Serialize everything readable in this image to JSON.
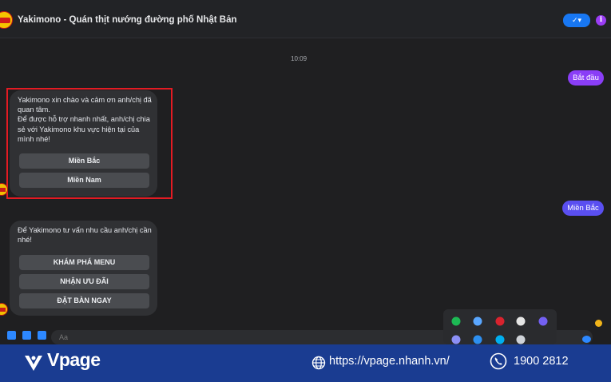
{
  "header": {
    "title": "Yakimono - Quán thịt nướng đường phố Nhật Bản",
    "seen_label": "✓▾",
    "info_label": "i"
  },
  "conversation": {
    "timestamp": "10:09",
    "user_messages": [
      "Bắt đầu",
      "Miền Bắc"
    ],
    "bot_message_1": {
      "text": "Yakimono xin chào và cảm ơn anh/chị đã quan tâm.\nĐể được hỗ trợ nhanh nhất, anh/chị chia sẻ với Yakimono khu vực hiện tại của mình nhé!",
      "buttons": [
        "Miền Bắc",
        "Miền Nam"
      ]
    },
    "bot_message_2": {
      "text": "Để Yakimono tư vấn nhu cầu anh/chị cần nhé!",
      "buttons": [
        "KHÁM PHÁ MENU",
        "NHẬN ƯU ĐÃI",
        "ĐẶT BÀN NGAY"
      ]
    }
  },
  "composer": {
    "placeholder": "Aa"
  },
  "tray": {
    "icons": [
      "spotify-icon",
      "onedrive-icon",
      "vivaldi-icon",
      "chrome-icon",
      "viber-icon",
      "send-icon",
      "edge-icon",
      "skype-icon",
      "gmail-icon"
    ],
    "colors": [
      "#1db954",
      "#5aa7ff",
      "#d9232e",
      "#e5e5e5",
      "#7360f2",
      "#8b8ff5",
      "#2d8ff0",
      "#00aff0",
      "#cfd3d8"
    ]
  },
  "footer": {
    "brand": "Vpage",
    "url": "https://vpage.nhanh.vn/",
    "phone": "1900 2812"
  },
  "colors": {
    "footer_bg": "#1a3c91",
    "user_bubble_1": "#8a3ef7",
    "user_bubble_2": "#5a4ff1",
    "highlight": "#e31b23"
  }
}
